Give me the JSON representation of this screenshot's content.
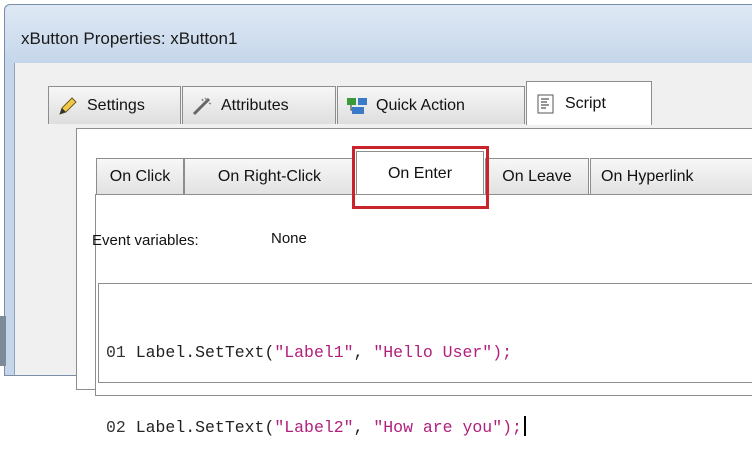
{
  "window": {
    "title": "xButton Properties: xButton1"
  },
  "main_tabs": [
    {
      "label": "Settings",
      "icon": "pencil-icon"
    },
    {
      "label": "Attributes",
      "icon": "wand-icon"
    },
    {
      "label": "Quick Action",
      "icon": "quick-action-icon"
    },
    {
      "label": "Script",
      "icon": "script-icon",
      "active": true
    }
  ],
  "script_tabs": [
    {
      "label": "On Click"
    },
    {
      "label": "On Right-Click"
    },
    {
      "label": "On Enter",
      "active": true
    },
    {
      "label": "On Leave"
    },
    {
      "label": "On Hyperlink"
    }
  ],
  "event_variables": {
    "label": "Event variables:",
    "value": "None"
  },
  "code": {
    "lines": [
      {
        "num": "01",
        "pre": "Label.SetText(",
        "arg1": "\"Label1\"",
        "sep": ", ",
        "arg2": "\"Hello User\"",
        "post": ");"
      },
      {
        "num": "02",
        "pre": "Label.SetText(",
        "arg1": "\"Label2\"",
        "sep": ", ",
        "arg2": "\"How are you\"",
        "post": ");"
      }
    ]
  },
  "colors": {
    "string": "#b0207d",
    "highlight": "#c9242b",
    "frame": "#c5d6ea"
  }
}
